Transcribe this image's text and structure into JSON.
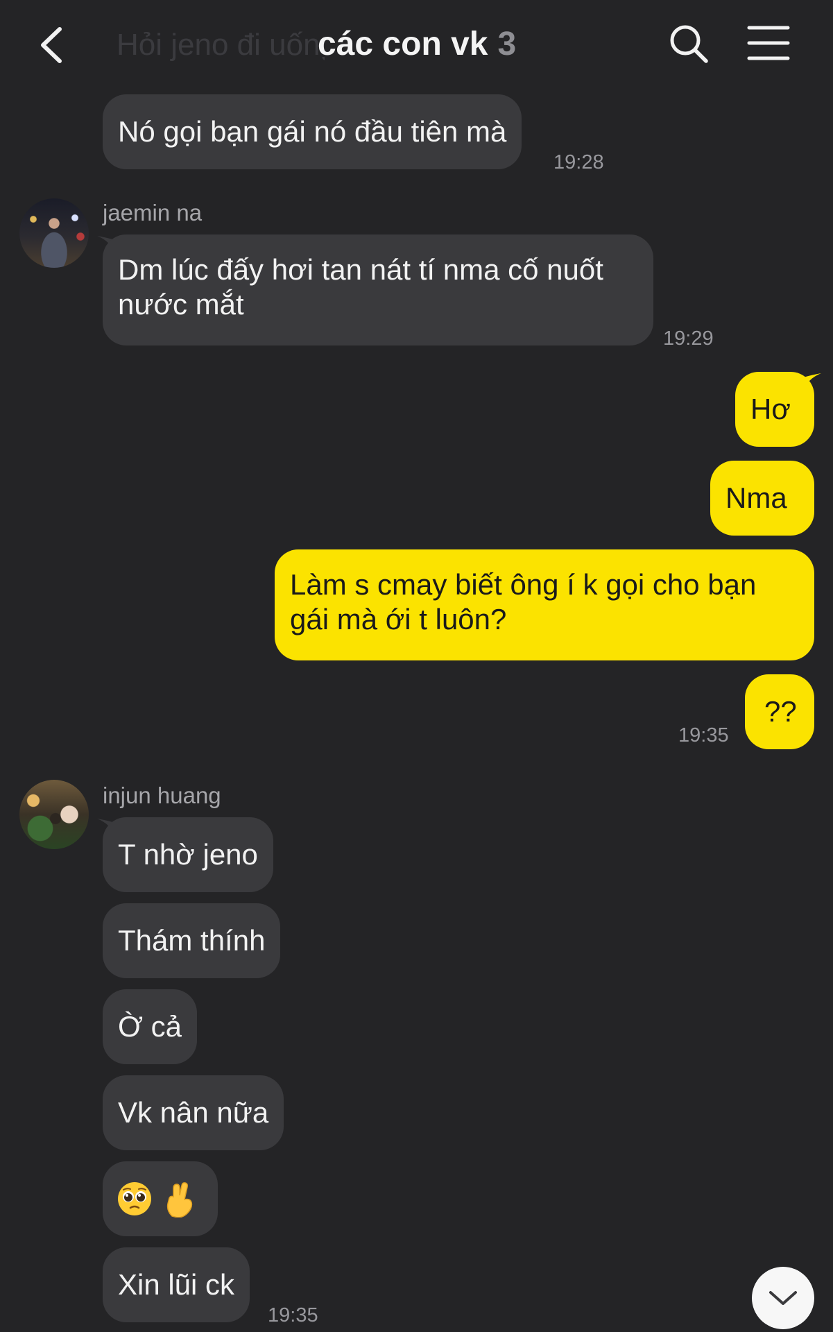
{
  "header": {
    "ghost_text": "Hỏi jeno đi uống",
    "title": "các con vk",
    "member_count": "3"
  },
  "messages": {
    "m1": {
      "text": "Nó gọi bạn gái nó đầu tiên mà",
      "time": "19:28"
    },
    "jaemin": {
      "sender": "jaemin na",
      "text": "Dm lúc đấy hơi tan nát tí nma cố nuốt nước mắt",
      "time": "19:29"
    },
    "out1": "Hơ",
    "out2": "Nma",
    "out3": "Làm s cmay biết ông í k gọi cho bạn gái mà ới t luôn?",
    "out4": "??",
    "out_time": "19:35",
    "injun": {
      "sender": "injun huang",
      "texts": [
        "T nhờ jeno",
        "Thám thính",
        "Ờ cả",
        "Vk nân nữa"
      ],
      "emojis": [
        "pleading-face-emoji",
        "crossed-fingers-emoji"
      ],
      "last": "Xin lũi ck",
      "time": "19:35"
    }
  },
  "colors": {
    "background": "#242426",
    "incoming_bubble": "#3a3a3d",
    "outgoing_bubble": "#fbe300"
  },
  "icons": {
    "back": "chevron-left-icon",
    "search": "search-icon",
    "menu": "hamburger-menu-icon",
    "scroll_down": "chevron-down-icon"
  }
}
